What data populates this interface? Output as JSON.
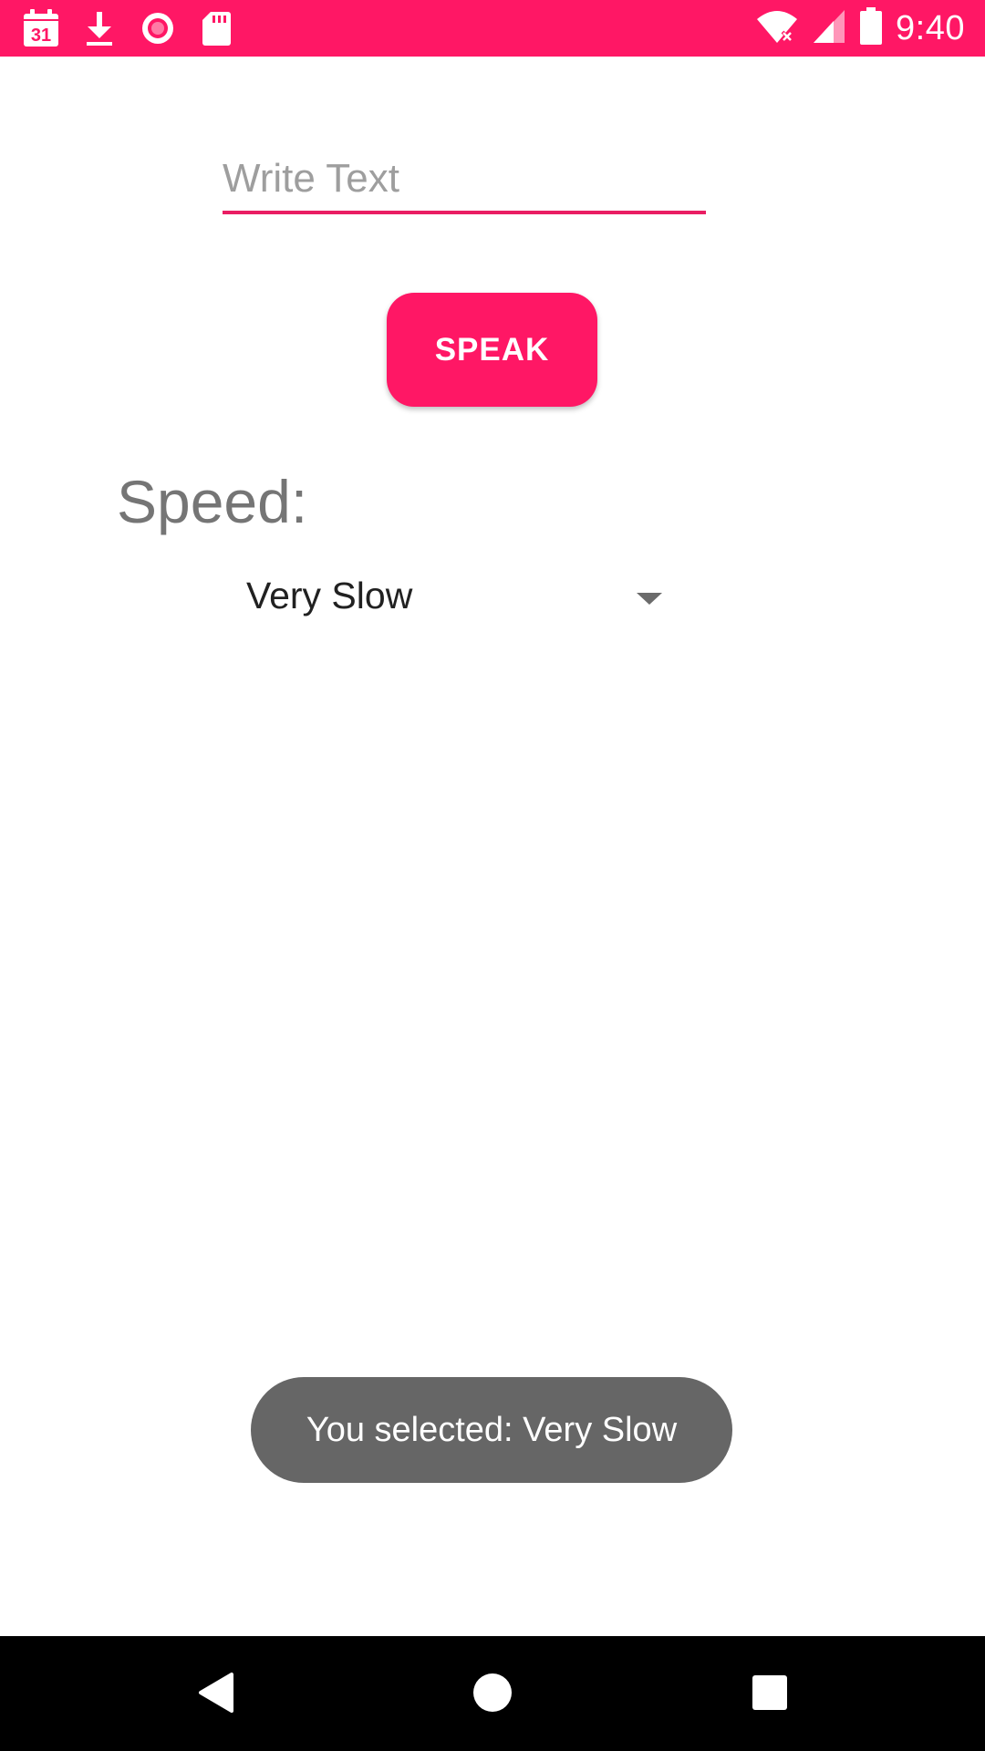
{
  "status_bar": {
    "background": "#FF1765",
    "calendar_day": "31",
    "time": "9:40",
    "left_icons": [
      "calendar-icon",
      "download-icon",
      "record-icon",
      "sd-card-icon"
    ],
    "right_icons": [
      "wifi-icon",
      "signal-icon",
      "battery-icon"
    ]
  },
  "text_input": {
    "placeholder": "Write Text",
    "value": "",
    "accent": "#E91E63"
  },
  "speak_button": {
    "label": "SPEAK",
    "color": "#FF1765"
  },
  "speed": {
    "label": "Speed:",
    "selected": "Very Slow"
  },
  "toast": {
    "message": "You selected: Very Slow"
  },
  "nav_bar": {
    "buttons": [
      "back-icon",
      "home-icon",
      "recents-icon"
    ]
  }
}
